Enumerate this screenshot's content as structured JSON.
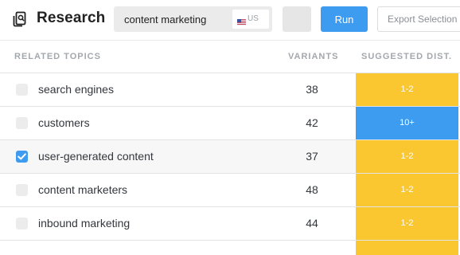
{
  "toolbar": {
    "title": "Research",
    "brand_icon": "research-icon",
    "search": {
      "value": "content marketing",
      "placeholder": ""
    },
    "country": {
      "flag_icon": "us-flag-icon",
      "label": "US"
    },
    "run_label": "Run",
    "export_label": "Export Selection"
  },
  "table": {
    "headers": {
      "topics": "RELATED TOPICS",
      "variants": "VARIANTS",
      "dist": "SUGGESTED DIST."
    },
    "rows": [
      {
        "topic": "search engines",
        "variants": "38",
        "dist": "1-2",
        "dist_color": "#fbc731",
        "checked": false
      },
      {
        "topic": "customers",
        "variants": "42",
        "dist": "10+",
        "dist_color": "#3d9bf0",
        "checked": false
      },
      {
        "topic": "user-generated content",
        "variants": "37",
        "dist": "1-2",
        "dist_color": "#fbc731",
        "checked": true
      },
      {
        "topic": "content marketers",
        "variants": "48",
        "dist": "1-2",
        "dist_color": "#fbc731",
        "checked": false
      },
      {
        "topic": "inbound marketing",
        "variants": "44",
        "dist": "1-2",
        "dist_color": "#fbc731",
        "checked": false
      }
    ],
    "partial_row": {
      "dist_color": "#fbc731"
    }
  },
  "colors": {
    "accent_blue": "#3d9bf0",
    "accent_yellow": "#fbc731"
  }
}
